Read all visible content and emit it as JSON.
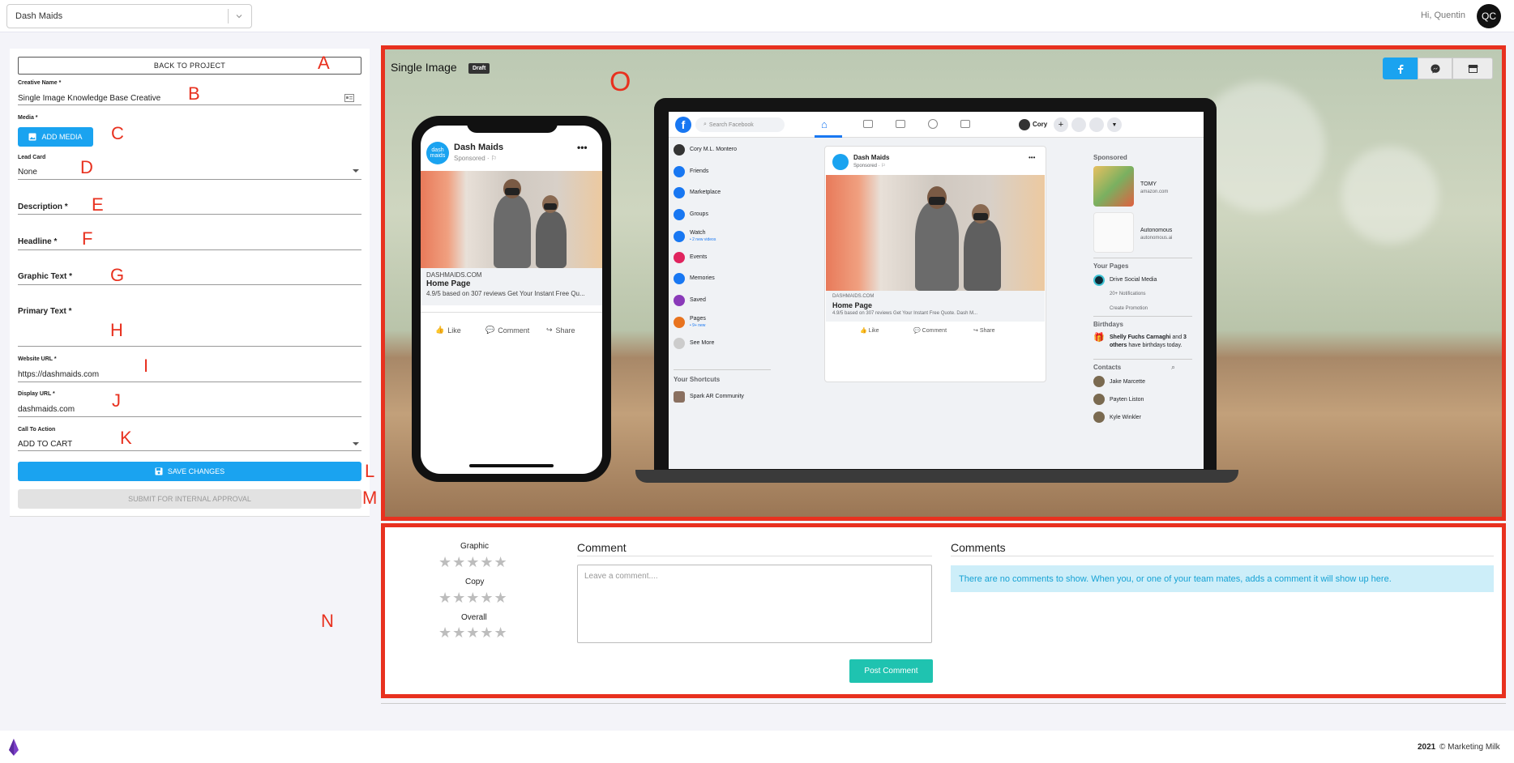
{
  "topbar": {
    "project": "Dash Maids",
    "greeting": "Hi, Quentin",
    "avatar_initials": "QC"
  },
  "form": {
    "back_label": "BACK TO PROJECT",
    "creative_name_label": "Creative Name *",
    "creative_name_value": "Single Image Knowledge Base Creative",
    "media_label": "Media *",
    "add_media_label": "ADD MEDIA",
    "lead_card_label": "Lead Card",
    "lead_card_value": "None",
    "description_label": "Description *",
    "headline_label": "Headline *",
    "graphic_text_label": "Graphic Text *",
    "primary_text_label": "Primary Text *",
    "website_url_label": "Website URL *",
    "website_url_value": "https://dashmaids.com",
    "display_url_label": "Display URL *",
    "display_url_value": "dashmaids.com",
    "cta_label": "Call To Action",
    "cta_value": "ADD TO CART",
    "save_label": "SAVE CHANGES",
    "submit_label": "SUBMIT FOR INTERNAL APPROVAL"
  },
  "markers": {
    "a": "A",
    "b": "B",
    "c": "C",
    "d": "D",
    "e": "E",
    "f": "F",
    "g": "G",
    "h": "H",
    "i": "I",
    "j": "J",
    "k": "K",
    "l": "L",
    "m": "M",
    "n": "N",
    "o": "O"
  },
  "preview": {
    "title": "Single Image",
    "status": "Draft",
    "phone": {
      "page_name": "Dash Maids",
      "sponsored": "Sponsored · ⚐",
      "logo_text": "dash maids",
      "domain": "DASHMAIDS.COM",
      "headline": "Home Page",
      "desc": "4.9/5 based on 307 reviews Get Your Instant Free Qu...",
      "like": "Like",
      "comment": "Comment",
      "share": "Share"
    },
    "desktop": {
      "search_placeholder": "Search Facebook",
      "user": "Cory",
      "left_nav": [
        {
          "label": "Cory M.L. Montero",
          "sub": ""
        },
        {
          "label": "Friends",
          "sub": ""
        },
        {
          "label": "Marketplace",
          "sub": ""
        },
        {
          "label": "Groups",
          "sub": ""
        },
        {
          "label": "Watch",
          "sub": "• 2 new videos"
        },
        {
          "label": "Events",
          "sub": ""
        },
        {
          "label": "Memories",
          "sub": ""
        },
        {
          "label": "Saved",
          "sub": ""
        },
        {
          "label": "Pages",
          "sub": "• 9+ new"
        },
        {
          "label": "See More",
          "sub": ""
        }
      ],
      "shortcuts_title": "Your Shortcuts",
      "shortcut": "Spark AR Community",
      "post": {
        "page_name": "Dash Maids",
        "sponsored": "Sponsored · ⚐",
        "domain": "DASHMAIDS.COM",
        "headline": "Home Page",
        "desc": "4.9/5 based on 307 reviews Get Your Instant Free Quote. Dash M...",
        "like": "Like",
        "comment": "Comment",
        "share": "Share"
      },
      "right": {
        "sponsored_title": "Sponsored",
        "ad1_name": "TOMY",
        "ad1_domain": "amazon.com",
        "ad2_name": "Autonomous",
        "ad2_domain": "autonomous.ai",
        "pages_title": "Your Pages",
        "page1": "Drive Social Media",
        "notifications": "20+ Notifications",
        "create_promotion": "Create Promotion",
        "birthdays_title": "Birthdays",
        "birthday_bold1": "Shelly Fuchs Carnaghi",
        "birthday_mid": " and ",
        "birthday_bold2": "3 others",
        "birthday_rest": " have birthdays today.",
        "contacts_title": "Contacts",
        "contacts": [
          "Jake Marcette",
          "Payten Liston",
          "Kyle Winkler"
        ]
      }
    }
  },
  "review": {
    "graphic_label": "Graphic",
    "copy_label": "Copy",
    "overall_label": "Overall",
    "stars": "★★★★★",
    "comment_title": "Comment",
    "comment_placeholder": "Leave a comment....",
    "post_label": "Post Comment",
    "comments_title": "Comments",
    "no_comments": "There are no comments to show. When you, or one of your team mates, adds a comment it will show up here."
  },
  "footer": {
    "year": "2021",
    "brand": "© Marketing Milk"
  },
  "colors": {
    "accent": "#1aa3f0",
    "annotation": "#e8311f",
    "post_button": "#1fc3b0",
    "fb_blue": "#1877f2"
  }
}
